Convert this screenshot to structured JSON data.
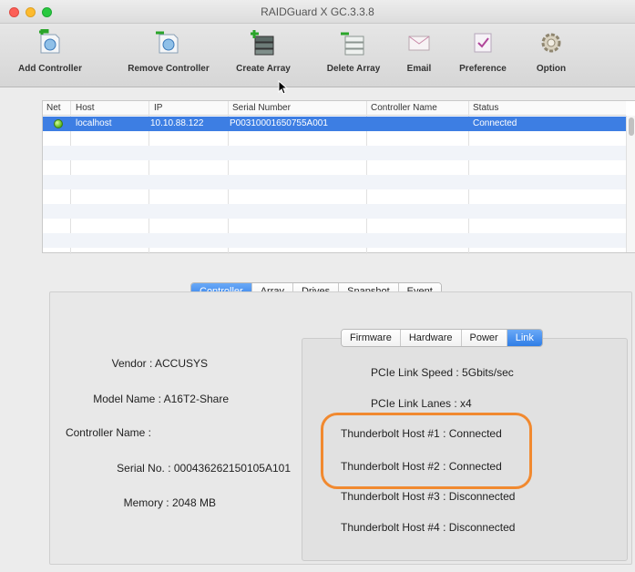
{
  "window": {
    "title": "RAIDGuard X GC.3.3.8"
  },
  "toolbar": {
    "buttons": [
      {
        "label": "Add Controller"
      },
      {
        "label": "Remove Controller"
      },
      {
        "label": "Create Array"
      },
      {
        "label": "Delete Array"
      },
      {
        "label": "Email"
      },
      {
        "label": "Preference"
      },
      {
        "label": "Option"
      }
    ]
  },
  "table": {
    "headers": [
      "Net",
      "Host",
      "IP",
      "Serial Number",
      "Controller Name",
      "Status"
    ],
    "rows": [
      {
        "host": "localhost",
        "ip": "10.10.88.122",
        "serial": "P00310001650755A001",
        "controller_name": "",
        "status": "Connected"
      }
    ]
  },
  "tabs": {
    "main": [
      "Controller",
      "Array",
      "Drives",
      "Snapshot",
      "Event"
    ],
    "main_active": "Controller",
    "sub": [
      "Firmware",
      "Hardware",
      "Power",
      "Link"
    ],
    "sub_active": "Link"
  },
  "controller_info": {
    "vendor": "Vendor : ACCUSYS",
    "model": "Model Name : A16T2-Share",
    "controller_name": "Controller Name :",
    "serial": "Serial No. : 000436262150105A101",
    "memory": "Memory : 2048 MB"
  },
  "link_info": {
    "speed": "PCIe Link Speed : 5Gbits/sec",
    "lanes": "PCIe Link Lanes : x4",
    "tb1": "Thunderbolt Host #1 : Connected",
    "tb2": "Thunderbolt Host #2 : Connected",
    "tb3": "Thunderbolt Host #3 : Disconnected",
    "tb4": "Thunderbolt Host #4 : Disconnected"
  },
  "colors": {
    "selection": "#3d7ee3",
    "active_tab": "#2f7de6",
    "highlight": "#f1892f"
  }
}
